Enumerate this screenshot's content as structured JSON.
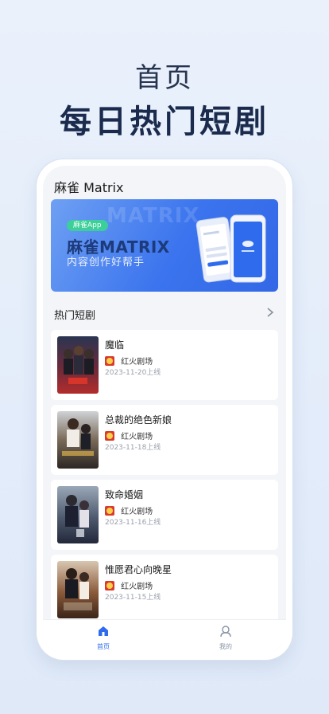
{
  "hero": {
    "subtitle": "首页",
    "title": "每日热门短剧"
  },
  "app": {
    "title": "麻雀 Matrix"
  },
  "banner": {
    "pill": "麻雀App",
    "title": "麻雀MATRIX",
    "subtitle": "内容创作好帮手",
    "watermark": "MATRIX"
  },
  "section": {
    "title": "热门短剧",
    "chevron_icon": "chevron-right-icon"
  },
  "dramas": [
    {
      "title": "魔临",
      "source": "红火剧场",
      "date": "2023-11-20上线",
      "poster_text": ""
    },
    {
      "title": "总裁的绝色新娘",
      "source": "红火剧场",
      "date": "2023-11-18上线",
      "poster_text": ""
    },
    {
      "title": "致命婚姻",
      "source": "红火剧场",
      "date": "2023-11-16上线",
      "poster_text": ""
    },
    {
      "title": "惟愿君心向晚星",
      "source": "红火剧场",
      "date": "2023-11-15上线",
      "poster_text": ""
    }
  ],
  "tabs": [
    {
      "label": "首页",
      "icon": "home-icon",
      "active": true
    },
    {
      "label": "我的",
      "icon": "profile-icon",
      "active": false
    }
  ],
  "colors": {
    "accent": "#2f6bed",
    "inactive": "#8a94a6",
    "hero_title": "#1b2b4e"
  }
}
